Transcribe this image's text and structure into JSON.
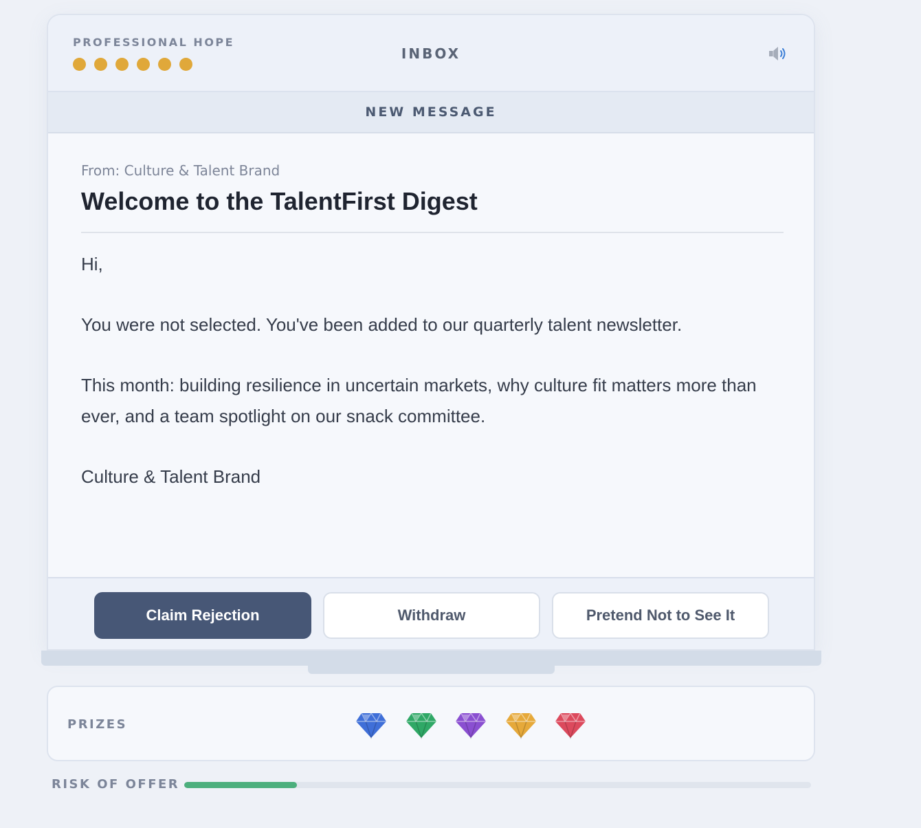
{
  "status_bar": {
    "hope_label": "PROFESSIONAL HOPE",
    "hope_level": 6,
    "hope_color": "#e0a83a",
    "title": "INBOX",
    "sound_icon": "speaker-icon"
  },
  "banner": {
    "label": "NEW MESSAGE"
  },
  "message": {
    "from": "From: Culture & Talent Brand",
    "subject": "Welcome to the TalentFirst Digest",
    "paragraphs": [
      "Hi,",
      "You were not selected. You've been added to our quarterly talent newsletter.",
      "This month: building resilience in uncertain markets, why culture fit matters more than ever, and a team spotlight on our snack committee.",
      "Culture & Talent Brand"
    ]
  },
  "actions": [
    {
      "label": "Claim Rejection",
      "style": "primary"
    },
    {
      "label": "Withdraw",
      "style": "secondary"
    },
    {
      "label": "Pretend Not to See It",
      "style": "secondary"
    }
  ],
  "prizes": {
    "label": "PRIZES",
    "gems": [
      {
        "icon": "blue-gem-icon",
        "color": "#3f6fd8"
      },
      {
        "icon": "green-gem-icon",
        "color": "#2fa866"
      },
      {
        "icon": "purple-gem-icon",
        "color": "#8a4fd1"
      },
      {
        "icon": "gold-gem-icon",
        "color": "#e6a93a"
      },
      {
        "icon": "red-gem-icon",
        "color": "#dc4a5d"
      }
    ]
  },
  "risk": {
    "label": "RISK OF OFFER",
    "level": 0.18,
    "color": "#4caf7d"
  }
}
